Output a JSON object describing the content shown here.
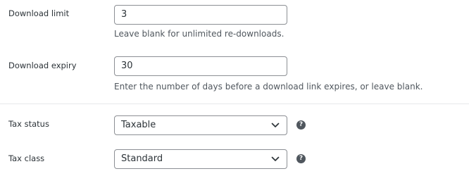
{
  "download_limit": {
    "label": "Download limit",
    "value": "3",
    "description": "Leave blank for unlimited re-downloads."
  },
  "download_expiry": {
    "label": "Download expiry",
    "value": "30",
    "description": "Enter the number of days before a download link expires, or leave blank."
  },
  "tax_status": {
    "label": "Tax status",
    "selected": "Taxable",
    "help_glyph": "?"
  },
  "tax_class": {
    "label": "Tax class",
    "selected": "Standard",
    "help_glyph": "?"
  },
  "icons": {
    "dropdown": "chevron-down-icon",
    "help": "help-icon"
  },
  "colors": {
    "border": "#8c8f94",
    "text": "#2c3338",
    "description": "#50575e",
    "divider": "#e7e8ea",
    "help_icon_bg": "#50575e"
  }
}
